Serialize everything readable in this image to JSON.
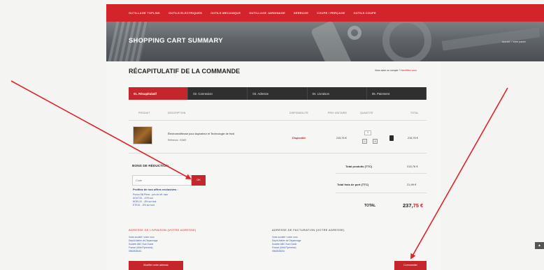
{
  "nav": {
    "items": [
      "OUTILLAGE TOPLINK",
      "OUTILS ELECTRIQUES",
      "OUTILS MECANIQUE",
      "OUTILLAGE JARDINAGE",
      "SERRAGE",
      "COUPE / PERÇAGE",
      "OUTILS COUPE"
    ]
  },
  "hero": {
    "title": "SHOPPING CART SUMMARY",
    "breadcrumb": "Accueil  >  Votre panier"
  },
  "page": {
    "title": "RÉCAPITULATIF DE LA COMMANDE",
    "already_prefix": "Vous avez un compte ?",
    "already_link": "Identifiez-vous"
  },
  "steps": [
    "01. Récapitulatif",
    "02. Connexion",
    "03. Adresse",
    "04. Livraison",
    "05. Paiement"
  ],
  "table": {
    "headers": [
      "PRODUIT",
      "DESCRIPTION",
      "DISPONIBILITÉ",
      "PRIX UNITAIRE",
      "QUANTITÉ",
      "TOTAL"
    ]
  },
  "product": {
    "name": "Électrorectifieuse pour Aspirateur et Technologie de froid",
    "reference": "Référence : 92669",
    "availability": "Disponible",
    "unit_price": "215,76 €",
    "quantity": "1",
    "minus": "−",
    "plus": "+",
    "total": "215,76 €"
  },
  "voucher": {
    "title": "BONS DE RÉDUCTION",
    "placeholder": "Code",
    "button": "OK",
    "offers_title": "Profitez de nos offres exclusives :",
    "offers": [
      "Promo Ski Pièce - prix de réf. max",
      "AOUT15 - -10% sur",
      "NOEL15 - -8% sur tout",
      "ETE15 - -5% sur tout"
    ]
  },
  "totals": {
    "products_label": "Total produits (TTC)",
    "products_value": "215,76 €",
    "shipping_label": "Total frais de port (TTC)",
    "shipping_value": "21,99 €",
    "total_label": "TOTAL",
    "total_value_main": "237,",
    "total_value_cents": "75 €"
  },
  "delivery": {
    "title": "ADRESSE DE LIVRAISON (VOTRE ADRESSE)",
    "lines": [
      "Votre société / votre nom",
      "Dépôt Atelier de Dépannage",
      "Société ABC Sud-Ouest",
      "France (Midi-Pyrénées)",
      "0562838181"
    ],
    "button": "Modifier votre adresse"
  },
  "invoice": {
    "title": "ADRESSE DE FACTURATION (VOTRE ADRESSE)",
    "lines": [
      "Votre société / votre nom",
      "Dépôt Atelier de Dépannage",
      "Société ABC Sud-Ouest",
      "France (Midi-Pyrénées)",
      "0562838181"
    ]
  },
  "actions": {
    "checkout": "Commander"
  },
  "colors": {
    "brand_red": "#d3242b",
    "step_dark": "#2f2f2f",
    "link_blue": "#3c5aa7"
  }
}
